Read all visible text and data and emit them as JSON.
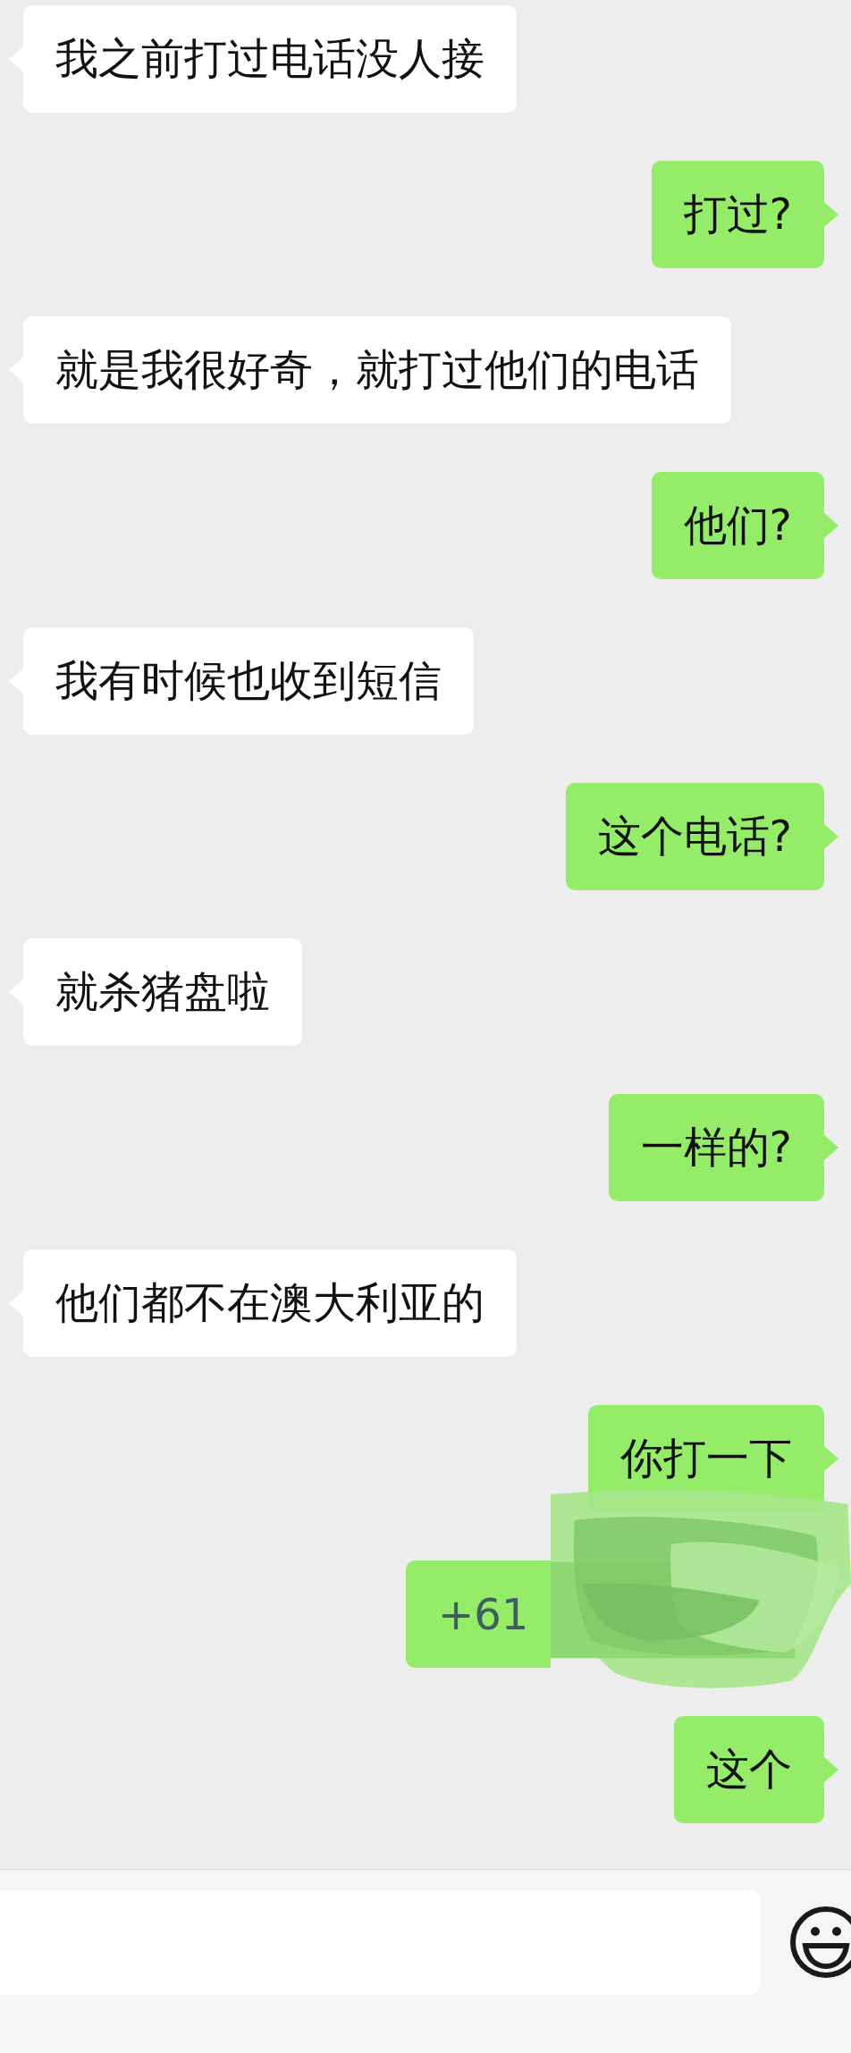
{
  "messages": [
    {
      "outgoing": false,
      "kind": "text",
      "text": "我之前打过电话没人接"
    },
    {
      "outgoing": true,
      "kind": "text",
      "text": "打过?"
    },
    {
      "outgoing": false,
      "kind": "text",
      "text": "就是我很好奇，就打过他们的电话"
    },
    {
      "outgoing": true,
      "kind": "text",
      "text": "他们?"
    },
    {
      "outgoing": false,
      "kind": "text",
      "text": "我有时候也收到短信"
    },
    {
      "outgoing": true,
      "kind": "text",
      "text": "这个电话?"
    },
    {
      "outgoing": false,
      "kind": "text",
      "text": "就杀猪盘啦"
    },
    {
      "outgoing": true,
      "kind": "text",
      "text": "一样的?"
    },
    {
      "outgoing": false,
      "kind": "text",
      "text": "他们都不在澳大利亚的"
    },
    {
      "outgoing": true,
      "kind": "text",
      "text": "你打一下"
    },
    {
      "outgoing": true,
      "kind": "phone",
      "text": "+61"
    },
    {
      "outgoing": true,
      "kind": "text",
      "text": "这个"
    }
  ],
  "composer": {
    "kind": "text"
  }
}
